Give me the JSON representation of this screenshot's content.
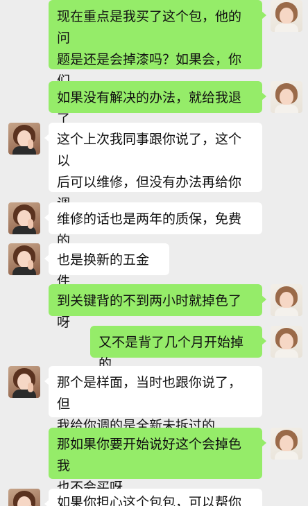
{
  "chat": {
    "messages": [
      {
        "side": "right",
        "text": "现在重点是我买了这个包，他的问\n题是还是会掉漆吗？如果会，你们\n会给我解决吗？"
      },
      {
        "side": "right",
        "text": "如果没有解决的办法，就给我退了"
      },
      {
        "side": "left",
        "text": "这个上次我同事跟你说了，这个以\n后可以维修，但没有办法再给你调\n换新的了"
      },
      {
        "side": "left",
        "text": "维修的话也是两年的质保，免费的"
      },
      {
        "side": "left",
        "text": "也是换新的五金件"
      },
      {
        "side": "right",
        "text": "到关键背的不到两小时就掉色了呀"
      },
      {
        "side": "right",
        "text": "又不是背了几个月开始掉的"
      },
      {
        "side": "left",
        "text": "那个是样面，当时也跟你说了，但\n我给你调的是全新未拆过的"
      },
      {
        "side": "right",
        "text": "那如果你要开始说好这个会掉色我\n也不会买呀"
      },
      {
        "side": "left",
        "text": "如果你担心这个包包，可以帮你调"
      }
    ]
  },
  "colors": {
    "background": "#ededed",
    "self_bubble": "#95ec69",
    "other_bubble": "#ffffff"
  }
}
